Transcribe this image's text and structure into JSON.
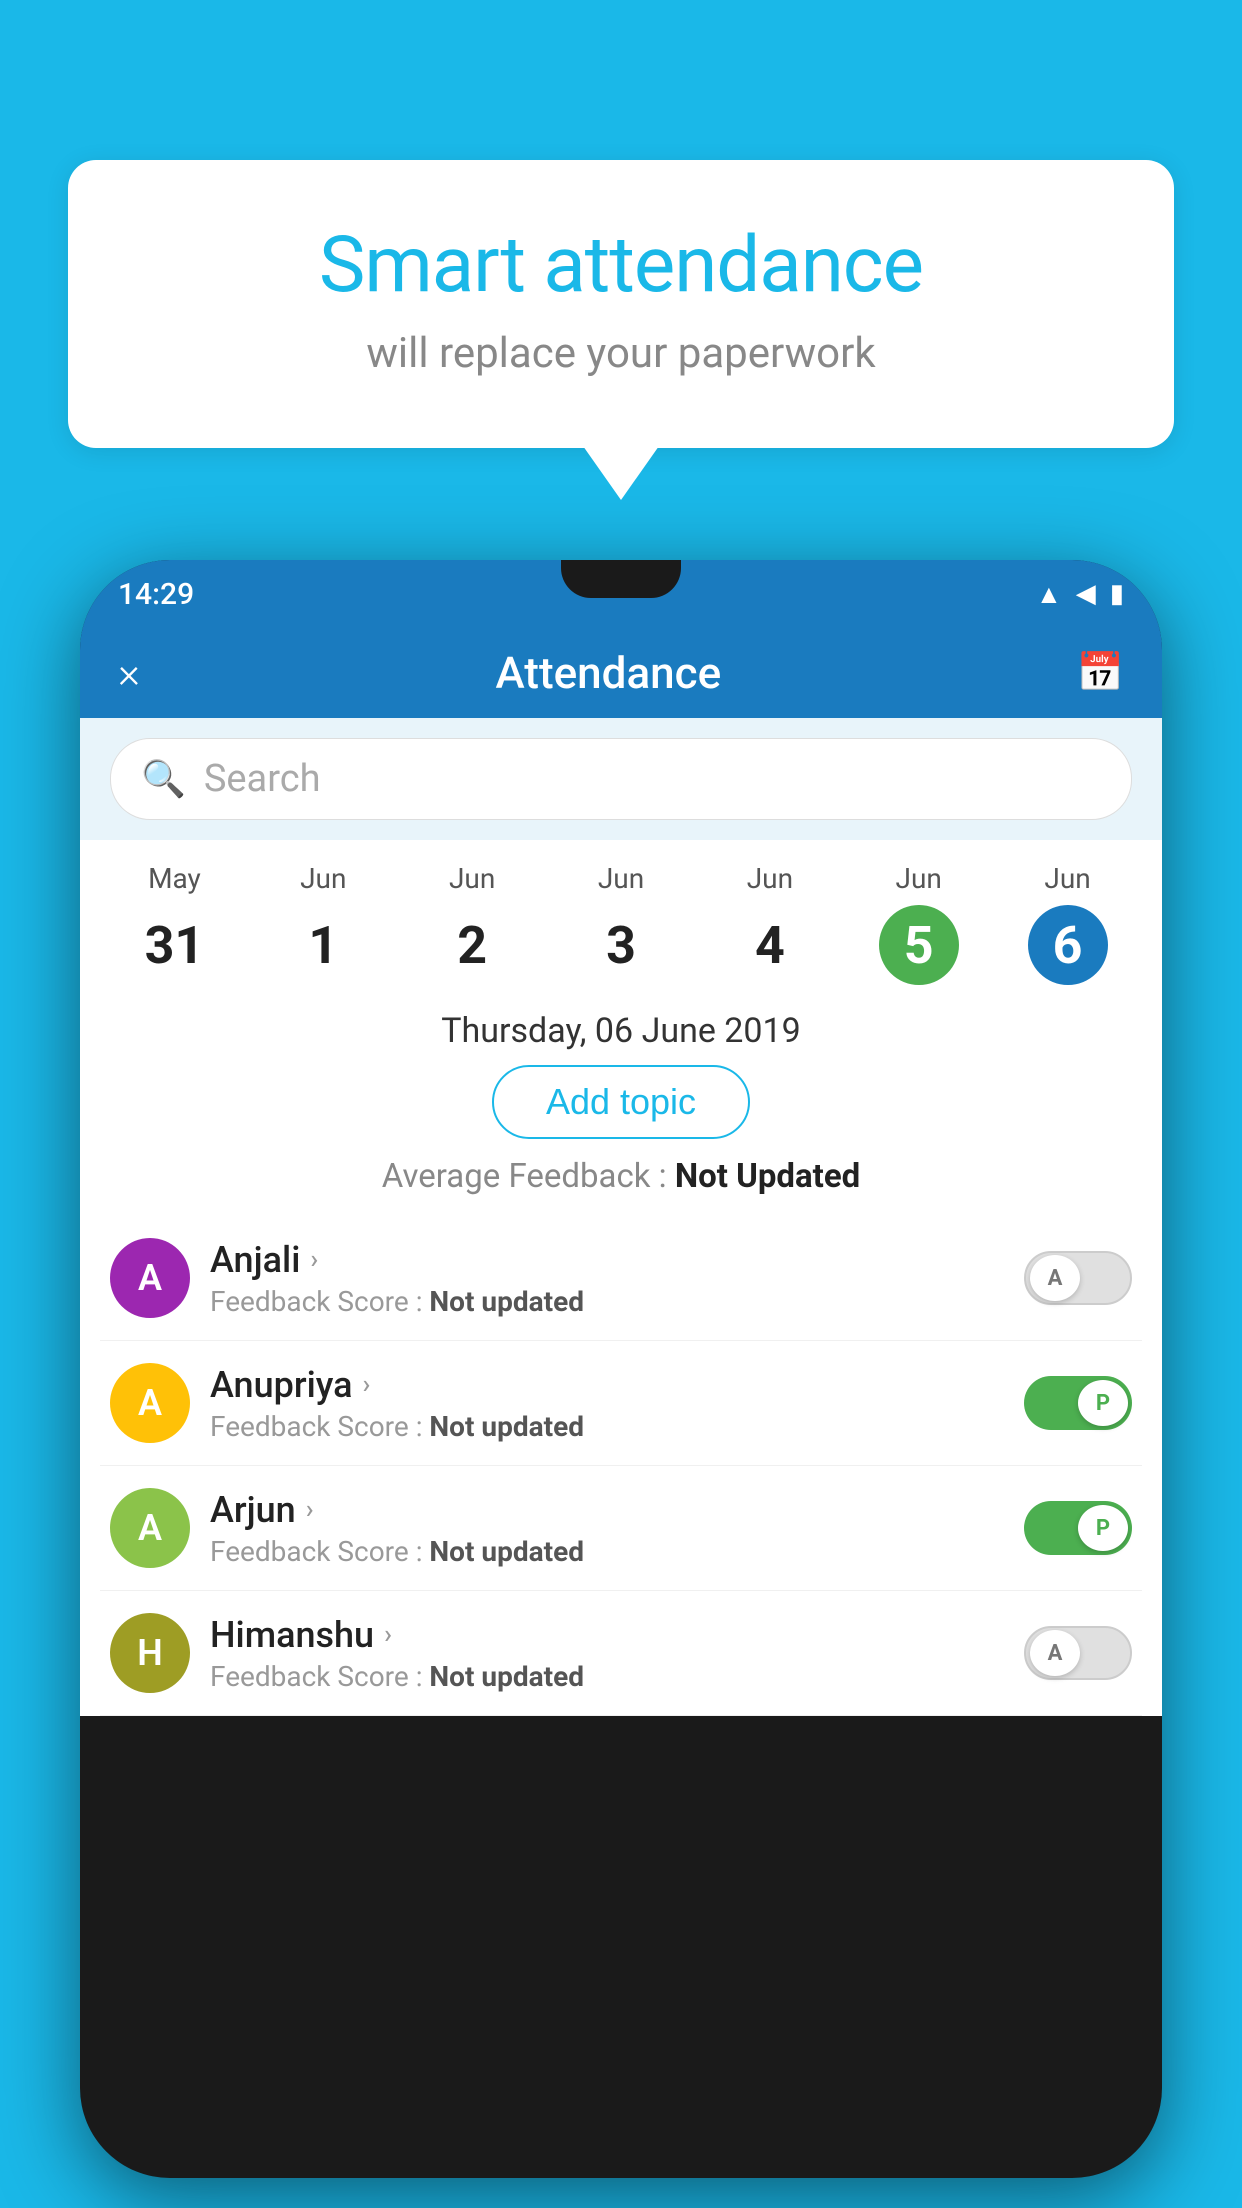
{
  "background_color": "#1ab8e8",
  "speech_bubble": {
    "title": "Smart attendance",
    "subtitle": "will replace your paperwork"
  },
  "status_bar": {
    "time": "14:29",
    "icons": [
      "wifi",
      "signal",
      "battery"
    ]
  },
  "app_header": {
    "title": "Attendance",
    "close_label": "×",
    "calendar_icon": "📅"
  },
  "search": {
    "placeholder": "Search"
  },
  "dates": [
    {
      "month": "May",
      "day": "31",
      "state": "normal"
    },
    {
      "month": "Jun",
      "day": "1",
      "state": "normal"
    },
    {
      "month": "Jun",
      "day": "2",
      "state": "normal"
    },
    {
      "month": "Jun",
      "day": "3",
      "state": "normal"
    },
    {
      "month": "Jun",
      "day": "4",
      "state": "normal"
    },
    {
      "month": "Jun",
      "day": "5",
      "state": "today"
    },
    {
      "month": "Jun",
      "day": "6",
      "state": "selected"
    }
  ],
  "selected_date_label": "Thursday, 06 June 2019",
  "add_topic_label": "Add topic",
  "avg_feedback_label": "Average Feedback : ",
  "avg_feedback_value": "Not Updated",
  "students": [
    {
      "name": "Anjali",
      "avatar_letter": "A",
      "avatar_color": "avatar-purple",
      "feedback_label": "Feedback Score : ",
      "feedback_value": "Not updated",
      "toggle_state": "off",
      "toggle_label": "A"
    },
    {
      "name": "Anupriya",
      "avatar_letter": "A",
      "avatar_color": "avatar-yellow",
      "feedback_label": "Feedback Score : ",
      "feedback_value": "Not updated",
      "toggle_state": "on",
      "toggle_label": "P"
    },
    {
      "name": "Arjun",
      "avatar_letter": "A",
      "avatar_color": "avatar-green",
      "feedback_label": "Feedback Score : ",
      "feedback_value": "Not updated",
      "toggle_state": "on",
      "toggle_label": "P"
    },
    {
      "name": "Himanshu",
      "avatar_letter": "H",
      "avatar_color": "avatar-olive",
      "feedback_label": "Feedback Score : ",
      "feedback_value": "Not updated",
      "toggle_state": "off",
      "toggle_label": "A"
    }
  ]
}
